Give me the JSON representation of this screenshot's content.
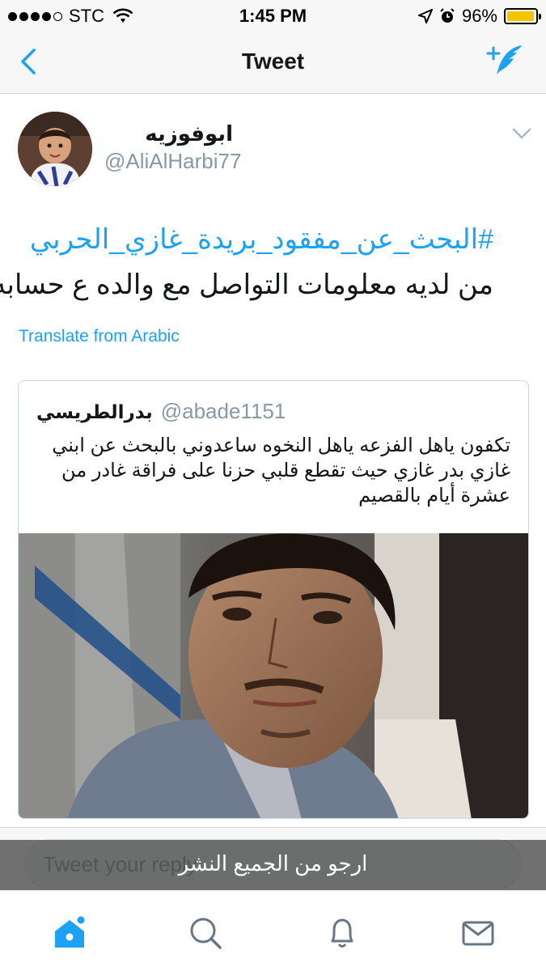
{
  "status_bar": {
    "carrier": "STC",
    "time": "1:45 PM",
    "battery_percent": "96%",
    "battery_level": 0.96,
    "signal_icon": "signal-dots-icon",
    "wifi_icon": "wifi-icon",
    "location_icon": "location-arrow-icon",
    "alarm_icon": "alarm-icon"
  },
  "nav": {
    "title": "Tweet",
    "back_icon": "chevron-left-icon",
    "compose_icon": "compose-tweet-icon"
  },
  "tweet": {
    "display_name": "ابوفوزيه",
    "handle": "@AliAlHarbi77",
    "hashtag": "#البحث_عن_مفقود_بريدة_غازي_الحربي",
    "text": "من لديه معلومات التواصل مع والده ع حسابه",
    "translate_label": "Translate from Arabic"
  },
  "quoted_tweet": {
    "display_name": "بدرالطريسي",
    "handle": "@abade1151",
    "text": "تكفون ياهل الفزعه ياهل النخوه ساعدوني بالبحث عن ابني غازي بدر غازي حيث تقطع قلبي حزنا على فراقة غادر من عشرة أيام بالقصيم"
  },
  "reply": {
    "placeholder": "Tweet your reply",
    "caption": "ارجو من الجميع النشر"
  },
  "tabs": [
    {
      "name": "home",
      "icon": "home-icon",
      "active": true
    },
    {
      "name": "search",
      "icon": "search-icon",
      "active": false
    },
    {
      "name": "notifications",
      "icon": "bell-icon",
      "active": false
    },
    {
      "name": "messages",
      "icon": "envelope-icon",
      "active": false
    }
  ],
  "colors": {
    "accent": "#1da1f2",
    "text": "#14171a",
    "secondary_text": "#8899a6",
    "battery": "#f5c400"
  }
}
